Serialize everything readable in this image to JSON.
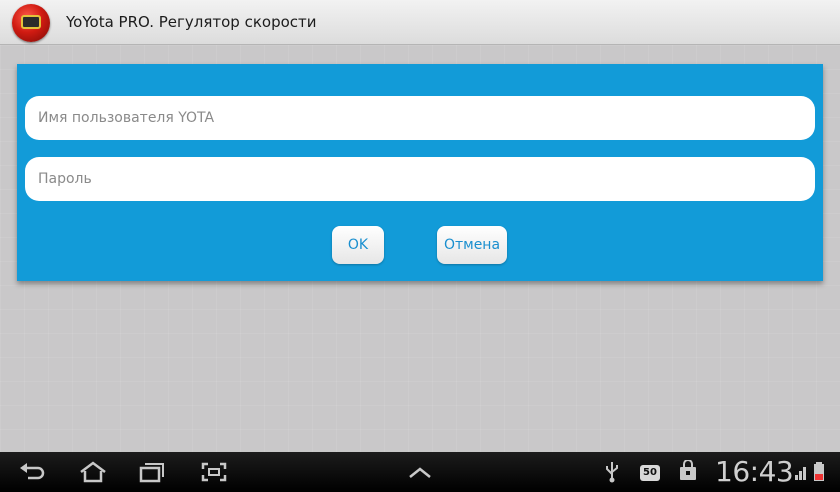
{
  "app": {
    "title": "YoYota PRO. Регулятор скорости",
    "icon": "speedometer-app-icon"
  },
  "login": {
    "username": {
      "value": "",
      "placeholder": "Имя пользователя YOTA"
    },
    "password": {
      "value": "",
      "placeholder": "Пароль"
    },
    "ok_label": "OK",
    "cancel_label": "Отмена"
  },
  "system_bar": {
    "time": "16:43",
    "notification_badge": "50",
    "icons": [
      "back-icon",
      "home-icon",
      "recent-apps-icon",
      "screenshot-icon",
      "chevron-up-icon",
      "usb-icon",
      "market-bag-icon",
      "signal-icon",
      "battery-icon"
    ]
  },
  "colors": {
    "panel": "#129bd8",
    "background": "#c9c8c9",
    "button_text": "#1a8fcf",
    "navbar": "#000000"
  }
}
